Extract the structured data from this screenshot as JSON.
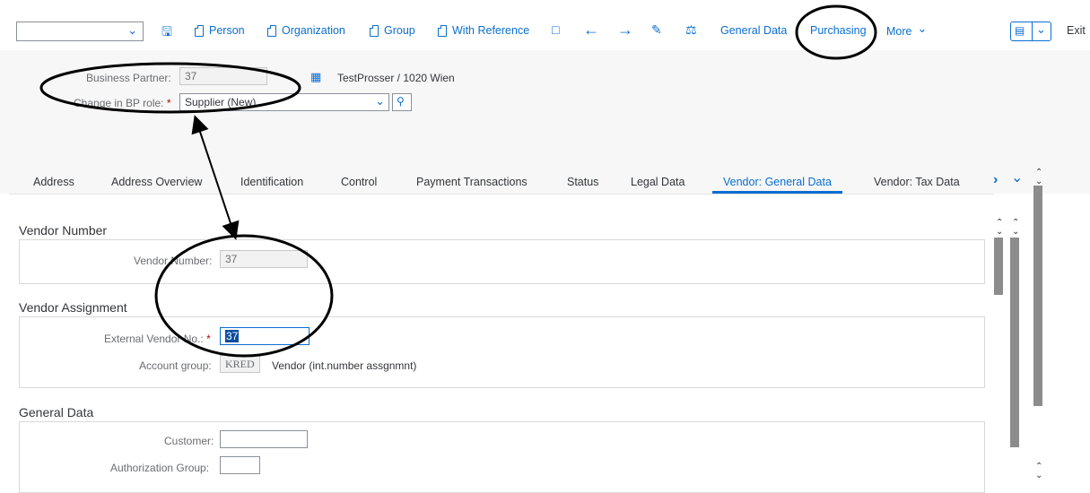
{
  "toolbar": {
    "person": "Person",
    "organization": "Organization",
    "group": "Group",
    "with_reference": "With Reference",
    "general_data": "General Data",
    "purchasing": "Purchasing",
    "more": "More",
    "exit": "Exit"
  },
  "header": {
    "bp_label": "Business Partner:",
    "bp_value": "37",
    "bp_desc": "TestProsser / 1020 Wien",
    "role_label": "Change in BP role:",
    "role_value": "Supplier (New)"
  },
  "tabs": [
    "Address",
    "Address Overview",
    "Identification",
    "Control",
    "Payment Transactions",
    "Status",
    "Legal Data",
    "Vendor: General Data",
    "Vendor: Tax Data"
  ],
  "sections": {
    "vendor_number": {
      "title": "Vendor Number",
      "label": "Vendor Number:",
      "value": "37"
    },
    "vendor_assignment": {
      "title": "Vendor Assignment",
      "ext_label": "External Vendor No.:",
      "ext_value": "37",
      "acct_label": "Account group:",
      "acct_value": "KRED",
      "acct_desc": "Vendor (int.number assgnmnt)"
    },
    "general_data": {
      "title": "General Data",
      "customer_label": "Customer:",
      "customer_value": "",
      "auth_label": "Authorization Group:",
      "auth_value": ""
    }
  },
  "colors": {
    "accent": "#0a6ed1",
    "required": "#bb0000",
    "annotation": "#000000"
  }
}
